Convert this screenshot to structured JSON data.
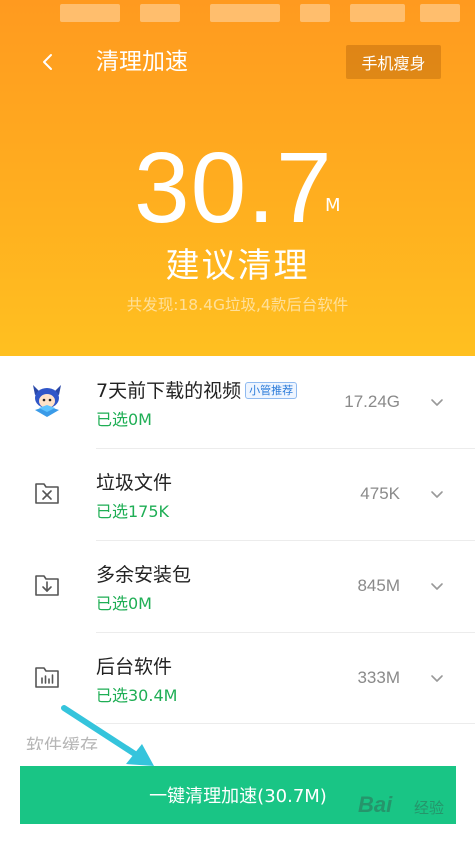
{
  "header": {
    "title": "清理加速",
    "slim_button": "手机瘦身",
    "size_value": "30.7",
    "size_unit": "M",
    "suggestion": "建议清理",
    "summary": "共发现:18.4G垃圾,4款后台软件"
  },
  "items": [
    {
      "icon": "mascot-icon",
      "title": "7天前下载的视频",
      "badge": "小管推荐",
      "selected": "已选0M",
      "size": "17.24G"
    },
    {
      "icon": "folder-x-icon",
      "title": "垃圾文件",
      "selected": "已选175K",
      "size": "475K"
    },
    {
      "icon": "folder-download-icon",
      "title": "多余安装包",
      "selected": "已选0M",
      "size": "845M"
    },
    {
      "icon": "folder-chart-icon",
      "title": "后台软件",
      "selected": "已选30.4M",
      "size": "333M"
    }
  ],
  "partial_item_title": "软件缓存",
  "action": {
    "label": "一键清理加速(30.7M)"
  },
  "watermark": {
    "brand": "Bai",
    "suffix": "经验"
  },
  "colors": {
    "header_top": "#ff9a1f",
    "header_bottom": "#ffc020",
    "accent_green": "#19c585",
    "selected_text": "#1fae55",
    "annotation_arrow": "#35c4dc"
  }
}
